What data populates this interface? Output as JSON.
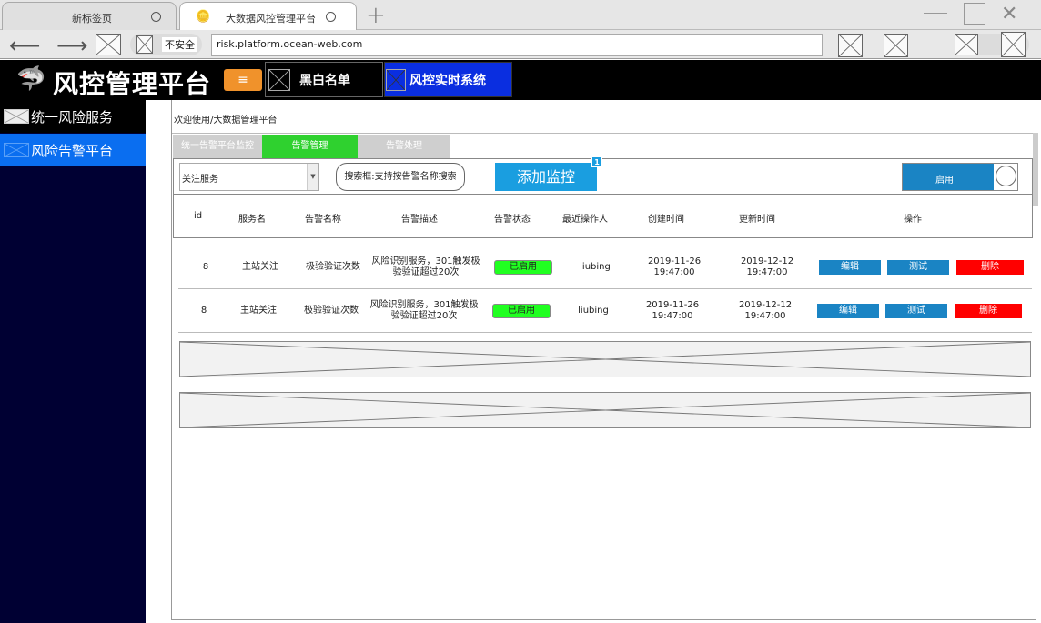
{
  "browser": {
    "tabs": [
      {
        "label": "新标签页"
      },
      {
        "label": "大数据风控管理平台"
      }
    ],
    "security_label": "不安全",
    "url": "risk.platform.ocean-web.com"
  },
  "header": {
    "title": "风控管理平台",
    "menu_icon": "≡",
    "nav": [
      {
        "label": "黑白名单"
      },
      {
        "label": "风控实时系统"
      }
    ]
  },
  "sidebar": {
    "items": [
      {
        "label": "统一风险服务"
      },
      {
        "label": "风险告警平台"
      }
    ]
  },
  "main": {
    "breadcrumb": "欢迎使用/大数据管理平台",
    "tabs": [
      {
        "label": "统一告警平台监控"
      },
      {
        "label": "告警管理"
      },
      {
        "label": "告警处理"
      }
    ],
    "toolbar": {
      "select_value": "关注服务",
      "search_label": "搜索框:支持按告警名称搜索",
      "add_label": "添加监控",
      "badge": "1",
      "toggle_label": "启用"
    },
    "table": {
      "columns": [
        "id",
        "服务名",
        "告警名称",
        "告警描述",
        "告警状态",
        "最近操作人",
        "创建时间",
        "更新时间",
        "操作"
      ],
      "rows": [
        {
          "id": "8",
          "service": "主站关注",
          "name": "极验验证次数",
          "desc": "风险识别服务，301触发极验验证超过20次",
          "status": "已启用",
          "operator": "liubing",
          "created": "2019-11-26 19:47:00",
          "updated": "2019-12-12 19:47:00",
          "actions": {
            "edit": "编辑",
            "test": "测试",
            "delete": "删除"
          }
        },
        {
          "id": "8",
          "service": "主站关注",
          "name": "极验验证次数",
          "desc": "风险识别服务，301触发极验验证超过20次",
          "status": "已启用",
          "operator": "liubing",
          "created": "2019-11-26 19:47:00",
          "updated": "2019-12-12 19:47:00",
          "actions": {
            "edit": "编辑",
            "test": "测试",
            "delete": "删除"
          }
        }
      ]
    }
  },
  "colors": {
    "accent_green": "#2fd12f",
    "accent_blue": "#1a9ee0",
    "danger": "#ff0000",
    "sidebar_bg": "#000033",
    "sidebar_active": "#0a6ef0"
  }
}
